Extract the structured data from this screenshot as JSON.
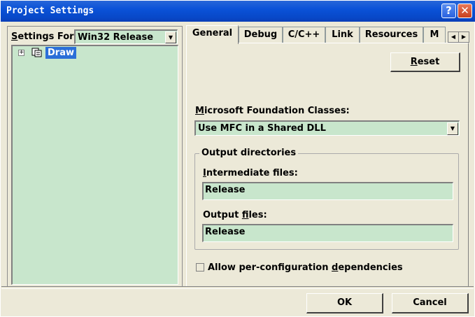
{
  "window": {
    "title": "Project Settings",
    "help": "?",
    "close": "✕"
  },
  "left": {
    "settings_for_label_u": "S",
    "settings_for_label_rest": "ettings For:",
    "config_value": "Win32 Release",
    "tree": {
      "expander": "+",
      "item": "Draw"
    }
  },
  "tabs": [
    "General",
    "Debug",
    "C/C++",
    "Link",
    "Resources",
    "M"
  ],
  "tab_scroll": {
    "left": "◀",
    "right": "▶"
  },
  "general": {
    "reset_u": "R",
    "reset_rest": "eset",
    "mfc_label_u": "M",
    "mfc_label_rest": "icrosoft Foundation Classes:",
    "mfc_value": "Use MFC in a Shared DLL",
    "output_dirs_title": "Output directories",
    "intermediate_label_u": "I",
    "intermediate_label_rest": "ntermediate files:",
    "intermediate_value": "Release",
    "output_label_pre": "Output ",
    "output_label_u": "f",
    "output_label_rest": "iles:",
    "output_value": "Release",
    "allow_pre": "Allow per-configuration ",
    "allow_u": "d",
    "allow_rest": "ependencies"
  },
  "footer": {
    "ok": "OK",
    "cancel": "Cancel"
  }
}
